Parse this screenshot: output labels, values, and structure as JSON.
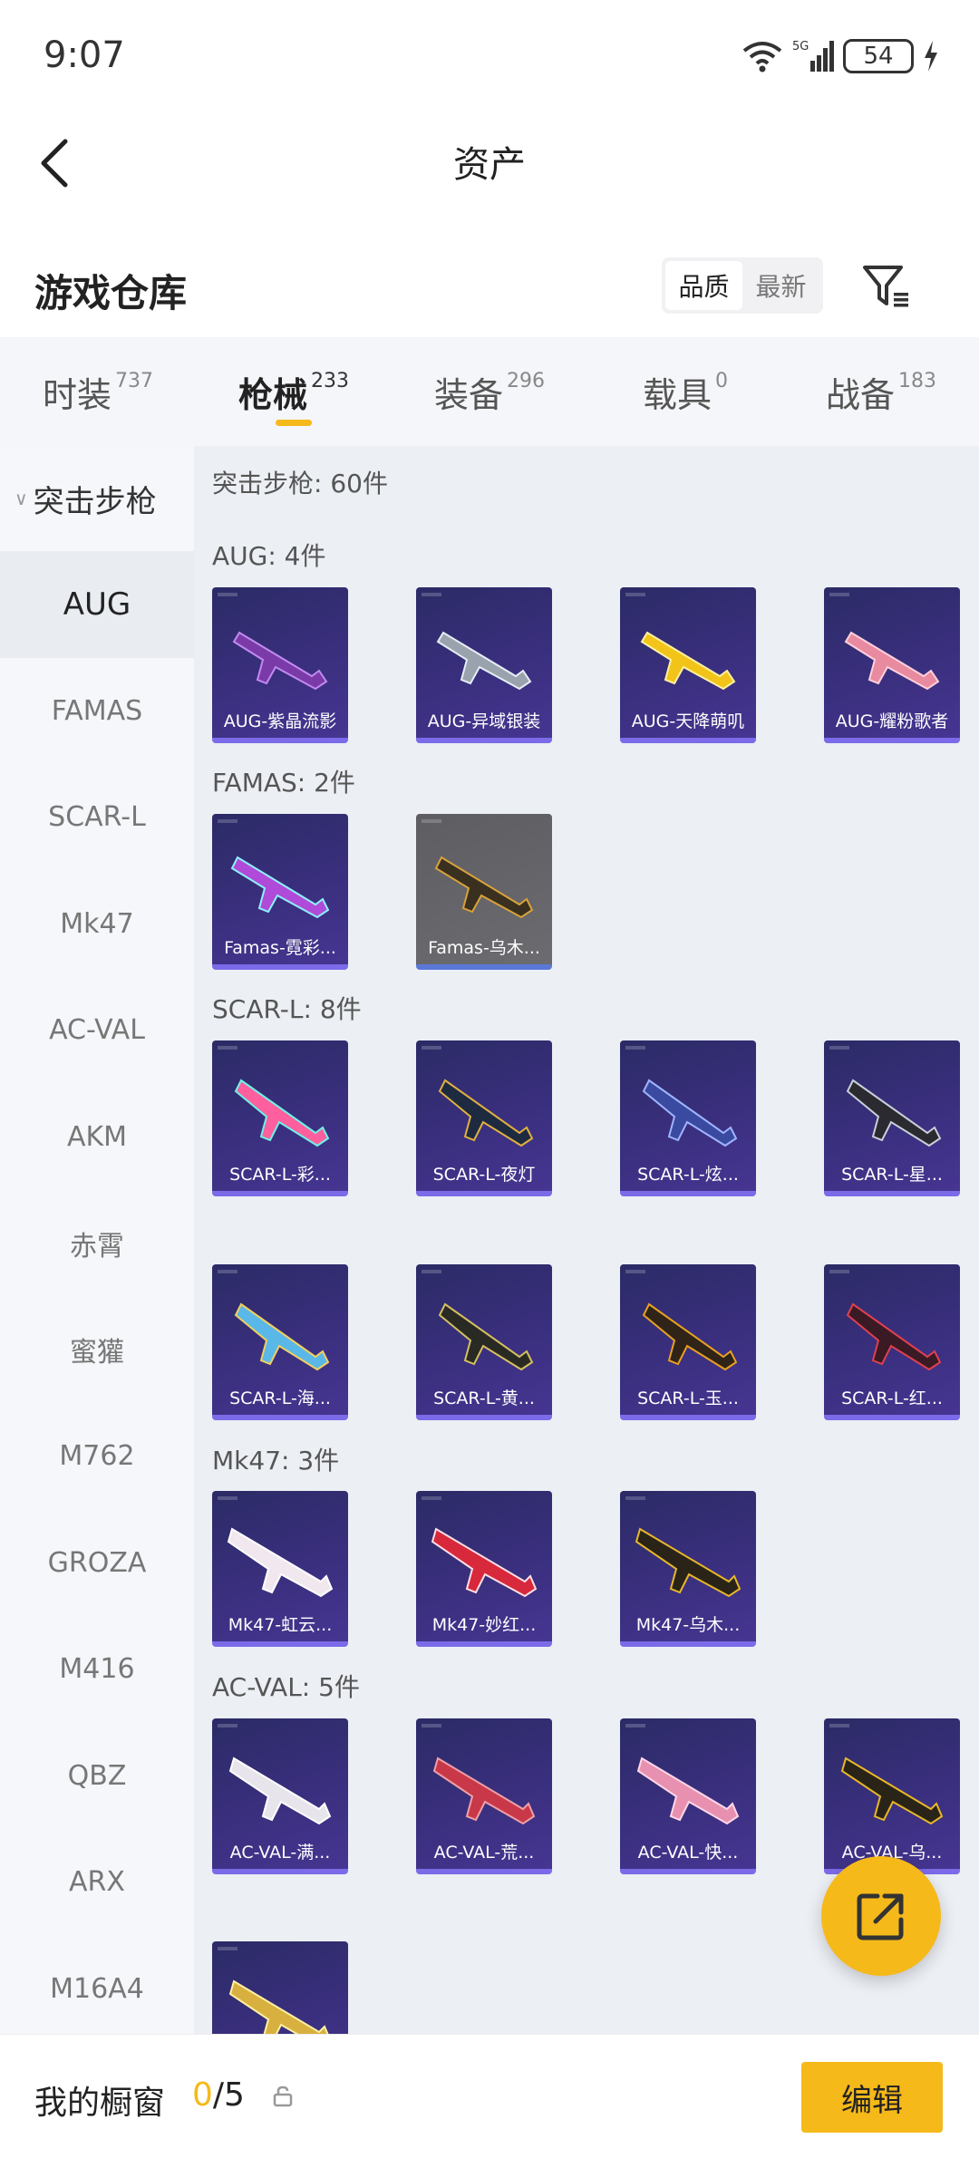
{
  "status_bar": {
    "time": "9:07",
    "battery": "54"
  },
  "header": {
    "title": "资产"
  },
  "warehouse": {
    "title": "游戏仓库",
    "sort_quality": "品质",
    "sort_newest": "最新"
  },
  "tabs": [
    {
      "label": "时装",
      "count": "737"
    },
    {
      "label": "枪械",
      "count": "233"
    },
    {
      "label": "装备",
      "count": "296"
    },
    {
      "label": "载具",
      "count": "0"
    },
    {
      "label": "战备",
      "count": "183"
    }
  ],
  "sidebar": {
    "category": "突击步枪",
    "items": [
      "AUG",
      "FAMAS",
      "SCAR-L",
      "Mk47",
      "AC-VAL",
      "AKM",
      "赤霄",
      "蜜獾",
      "M762",
      "GROZA",
      "M416",
      "QBZ",
      "ARX",
      "M16A4"
    ]
  },
  "content": {
    "header": "突击步枪: 60件",
    "groups": [
      {
        "title": "AUG: 4件",
        "items": [
          "AUG-紫晶流影",
          "AUG-异域银装",
          "AUG-天降萌叽",
          "AUG-耀粉歌者"
        ]
      },
      {
        "title": "FAMAS: 2件",
        "items": [
          "Famas-霓彩...",
          "Famas-乌木..."
        ]
      },
      {
        "title": "SCAR-L: 8件",
        "items": [
          "SCAR-L-彩...",
          "SCAR-L-夜灯",
          "SCAR-L-炫...",
          "SCAR-L-星...",
          "SCAR-L-海...",
          "SCAR-L-黄...",
          "SCAR-L-玉...",
          "SCAR-L-红..."
        ]
      },
      {
        "title": "Mk47: 3件",
        "items": [
          "Mk47-虹云...",
          "Mk47-妙红...",
          "Mk47-乌木..."
        ]
      },
      {
        "title": "AC-VAL: 5件",
        "items": [
          "AC-VAL-满...",
          "AC-VAL-荒...",
          "AC-VAL-快...",
          "AC-VAL-乌...",
          ""
        ]
      }
    ]
  },
  "bottom_bar": {
    "showcase_label": "我的橱窗",
    "showcase_current": "0",
    "showcase_total": "/5",
    "edit_label": "编辑"
  },
  "colors": {
    "accent": "#f6b91a",
    "card_bg": "#3a2f7e",
    "card_border": "#7b6be8"
  }
}
